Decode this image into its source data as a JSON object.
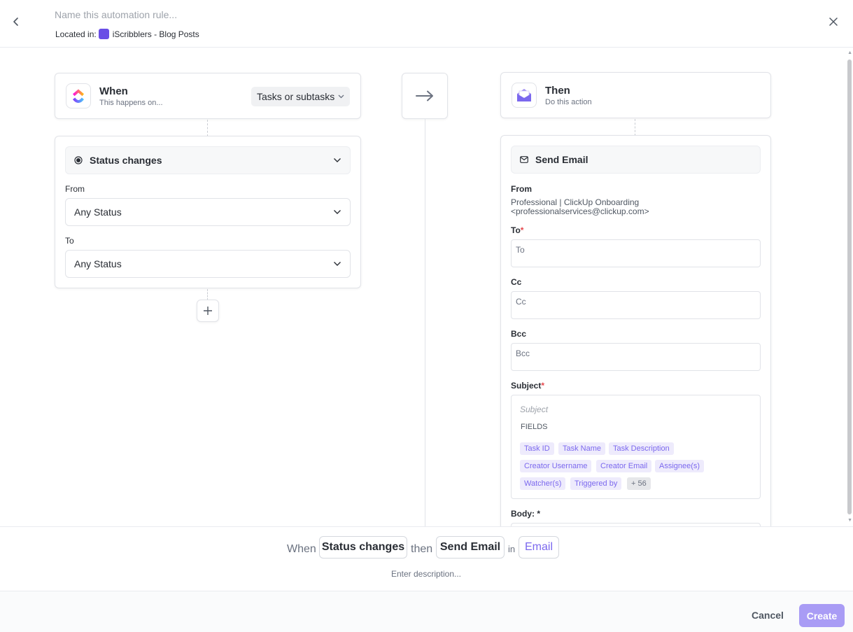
{
  "header": {
    "name_placeholder": "Name this automation rule...",
    "located_label": "Located in:",
    "location_name": "iScribblers - Blog Posts",
    "space_color": "#6a4ee6"
  },
  "trigger_card": {
    "title": "When",
    "subtitle": "This happens on...",
    "scope": "Tasks or subtasks",
    "icon": "clickup-logo-icon"
  },
  "trigger": {
    "label": "Status changes",
    "from_label": "From",
    "from_value": "Any Status",
    "to_label": "To",
    "to_value": "Any Status"
  },
  "action_card": {
    "title": "Then",
    "subtitle": "Do this action",
    "icon": "envelope-open-icon"
  },
  "action": {
    "label": "Send Email",
    "from_label": "From",
    "from_value_line1": "Professional | ClickUp Onboarding",
    "from_value_line2": "<professionalservices@clickup.com>",
    "to_label": "To",
    "to_placeholder": "To",
    "cc_label": "Cc",
    "cc_placeholder": "Cc",
    "bcc_label": "Bcc",
    "bcc_placeholder": "Bcc",
    "subject_label": "Subject",
    "subject_placeholder": "Subject",
    "fields_label": "FIELDS",
    "fields": [
      "Task ID",
      "Task Name",
      "Task Description",
      "Creator Username",
      "Creator Email",
      "Assignee(s)",
      "Watcher(s)",
      "Triggered by"
    ],
    "more_fields": "+ 56",
    "body_label": "Body:",
    "required_mark": "*"
  },
  "summary": {
    "when_word": "When",
    "trigger_chip": "Status changes",
    "then_word": "then",
    "action_chip": "Send Email",
    "in_word": "in",
    "category_chip": "Email",
    "description_placeholder": "Enter description..."
  },
  "footer": {
    "cancel_label": "Cancel",
    "create_label": "Create"
  },
  "colors": {
    "accent": "#7b68ee",
    "create_button_disabled": "#a99cf5",
    "required": "#e5484d"
  }
}
